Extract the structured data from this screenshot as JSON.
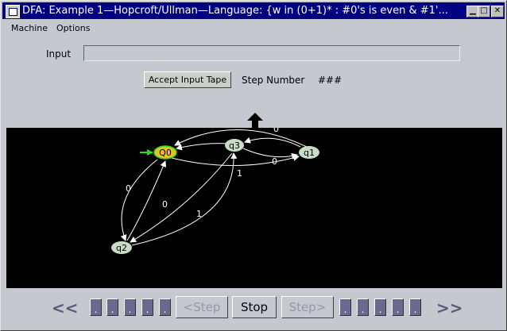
{
  "window": {
    "title": "DFA: Example 1—Hopcroft/Ullman—Language: {w in (0+1)* : #0's is even & #1'...",
    "minimize_icon": "minimize-icon",
    "maximize_icon": "maximize-icon",
    "close_icon": "close-icon"
  },
  "menubar": {
    "items": [
      {
        "label": "Machine"
      },
      {
        "label": "Options"
      }
    ]
  },
  "input": {
    "label": "Input",
    "value": ""
  },
  "accept_button": {
    "label": "Accept Input Tape"
  },
  "step": {
    "label": "Step Number",
    "value": "###"
  },
  "diagram": {
    "background": "#000000",
    "current_state_color": "#e8c020",
    "state_color": "#c8dcc8",
    "start_arrow_color": "#20e020",
    "states": [
      {
        "id": "Q0",
        "label": "Q0",
        "current": true,
        "start": true
      },
      {
        "id": "q3",
        "label": "q3",
        "current": false,
        "start": false
      },
      {
        "id": "q1",
        "label": "q1",
        "current": false,
        "start": false
      },
      {
        "id": "q2",
        "label": "q2",
        "current": false,
        "start": false
      }
    ],
    "transitions": [
      {
        "from": "q1",
        "to": "q3",
        "label": "0"
      },
      {
        "from": "q3",
        "to": "q1",
        "label": "0"
      },
      {
        "from": "Q0",
        "to": "q1",
        "label": "1"
      },
      {
        "from": "q1",
        "to": "Q0",
        "label": ""
      },
      {
        "from": "q3",
        "to": "Q0",
        "label": ""
      },
      {
        "from": "Q0",
        "to": "q2",
        "label": "0"
      },
      {
        "from": "q2",
        "to": "Q0",
        "label": "0"
      },
      {
        "from": "q2",
        "to": "q3",
        "label": "1"
      },
      {
        "from": "q3",
        "to": "q2",
        "label": ""
      }
    ]
  },
  "controls": {
    "rewind_label": "<<",
    "forward_label": ">>",
    "step_back_label": "<Step",
    "stop_label": "Stop",
    "step_forward_label": "Step>",
    "dot_label": "."
  }
}
